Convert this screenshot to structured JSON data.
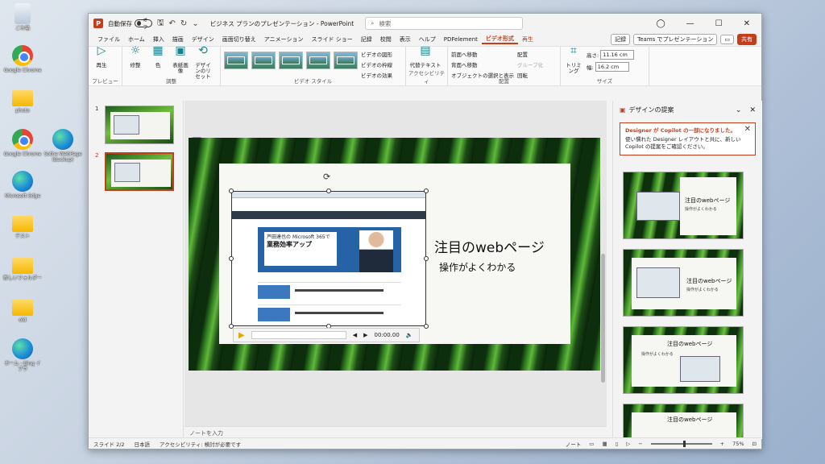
{
  "desktop": {
    "icons": [
      {
        "label": "ごみ箱",
        "icon": "recycle-bin-icon"
      },
      {
        "label": "Google Chrome",
        "icon": "chrome-icon"
      },
      {
        "label": "photo",
        "icon": "folder-icon"
      },
      {
        "label": "Google Chrome",
        "icon": "chrome-icon"
      },
      {
        "label": "Microsoft Edge",
        "icon": "edge-icon"
      },
      {
        "label": "テスト",
        "icon": "folder-icon"
      },
      {
        "label": "新しいフォルダー",
        "icon": "folder-icon"
      },
      {
        "label": "old",
        "icon": "folder-icon"
      },
      {
        "label": "ホーム - Bing イブラ",
        "icon": "edge-icon"
      },
      {
        "label": "Sothe WebPage (Backup)",
        "icon": "edge-icon"
      }
    ]
  },
  "titlebar": {
    "autosave_label": "自動保存",
    "autosave_state": "オフ",
    "document_title": "ビジネス プランのプレゼンテーション - PowerPoint",
    "search_placeholder": "検索"
  },
  "tabs": [
    "ファイル",
    "ホーム",
    "挿入",
    "描画",
    "デザイン",
    "画面切り替え",
    "アニメーション",
    "スライド ショー",
    "記録",
    "校閲",
    "表示",
    "ヘルプ",
    "PDFelement",
    "ビデオ形式",
    "再生"
  ],
  "active_tab": "ビデオ形式",
  "ribbon_buttons": {
    "record": "記録",
    "teams": "Teams でプレゼンテーション",
    "share": "共有"
  },
  "ribbon": {
    "preview": {
      "play": "再生",
      "group": "プレビュー"
    },
    "adjust": {
      "brightness": "修整",
      "color": "色",
      "poster": "表紙画像",
      "reset": "デザインのリセット",
      "group": "調整"
    },
    "video_styles": {
      "shape": "ビデオの図形",
      "border": "ビデオの枠線",
      "effects": "ビデオの効果",
      "group": "ビデオ スタイル"
    },
    "accessibility": {
      "alt": "代替テキスト",
      "group": "アクセシビリティ"
    },
    "arrange": {
      "forward": "前面へ移動",
      "backward": "背面へ移動",
      "selection": "オブジェクトの選択と表示",
      "align": "配置",
      "group_btn": "グループ化",
      "rotate": "回転",
      "group": "配置"
    },
    "size": {
      "crop": "トリミング",
      "height_label": "高さ:",
      "height": "11.16 cm",
      "width_label": "幅:",
      "width": "16.2 cm",
      "group": "サイズ"
    }
  },
  "thumbnails": [
    {
      "num": "1"
    },
    {
      "num": "2"
    }
  ],
  "slide": {
    "title": "注目のwebページ",
    "subtitle": "操作がよくわかる",
    "video_banner_small": "芦田達也の",
    "video_banner_brand": "Microsoft 365で",
    "video_banner_main": "業務効率アップ",
    "video_time": "00:00.00"
  },
  "notes_placeholder": "ノートを入力",
  "designer": {
    "title": "デザインの提案",
    "notice_title": "Designer が Copilot の一部になりました。",
    "notice_body": "使い慣れた Designer レイアウトと共に、新しい Copilot の提案をご確認ください。",
    "suggestion_title": "注目のwebページ",
    "suggestion_sub": "操作がよくわかる"
  },
  "statusbar": {
    "slide": "スライド 2/2",
    "language": "日本語",
    "accessibility": "アクセシビリティ: 検討が必要です",
    "notes": "ノート",
    "zoom": "75%"
  }
}
